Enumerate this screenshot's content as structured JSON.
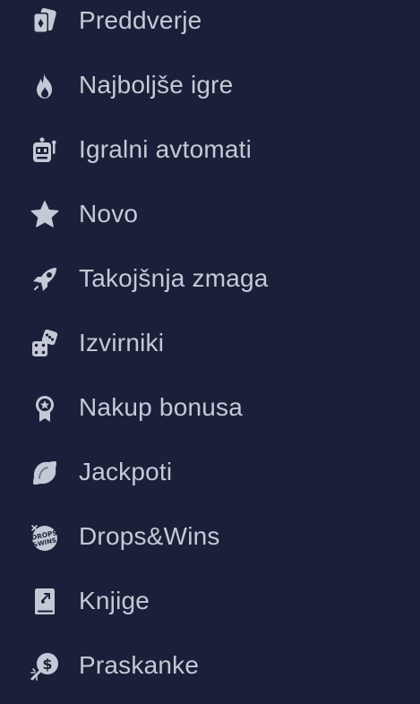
{
  "menu": {
    "items": [
      {
        "label": "Preddverje",
        "icon": "lobby-cards-icon"
      },
      {
        "label": "Najboljše igre",
        "icon": "fire-icon"
      },
      {
        "label": "Igralni avtomati",
        "icon": "slot-machine-icon"
      },
      {
        "label": "Novo",
        "icon": "star-icon"
      },
      {
        "label": "Takojšnja zmaga",
        "icon": "instant-win-rocket-icon"
      },
      {
        "label": "Izvirniki",
        "icon": "dice-icon"
      },
      {
        "label": "Nakup bonusa",
        "icon": "award-badge-icon"
      },
      {
        "label": "Jackpoti",
        "icon": "lemon-icon"
      },
      {
        "label": "Drops&Wins",
        "icon": "drops-wins-icon"
      },
      {
        "label": "Knjige",
        "icon": "book-icon"
      },
      {
        "label": "Praskanke",
        "icon": "scratch-coin-icon"
      }
    ]
  },
  "colors": {
    "background": "#1a2039",
    "text": "#c5c9d6",
    "icon": "#c5c9d6"
  }
}
